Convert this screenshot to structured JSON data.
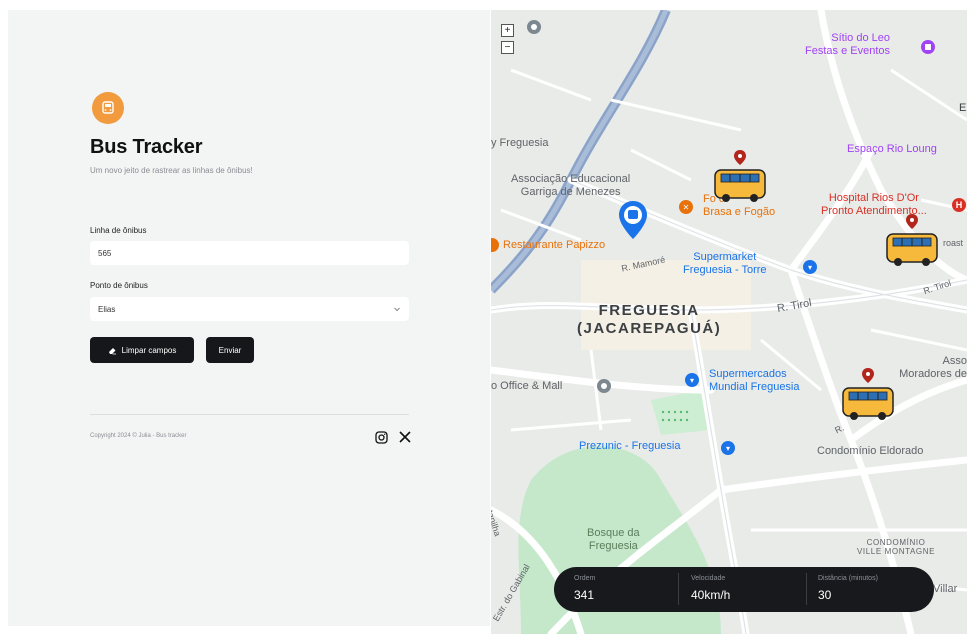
{
  "app": {
    "title": "Bus Tracker",
    "subtitle": "Um novo jeito de rastrear as linhas de ônibus!",
    "logo_icon": "bus-icon",
    "accent": "#f19a3e"
  },
  "form": {
    "line_label": "Linha de ônibus",
    "line_value": "565",
    "stop_label": "Ponto de ônibus",
    "stop_value": "Elias",
    "clear_button": "Limpar campos",
    "submit_button": "Enviar"
  },
  "footer": {
    "copyright": "Copyright 2024 © Julia - Bus tracker",
    "social": [
      "instagram-icon",
      "x-icon"
    ]
  },
  "map": {
    "zoom_in": "+",
    "zoom_out": "−",
    "district": [
      "FREGUESIA",
      "(JACAREPAGUÁ)"
    ],
    "places": {
      "sitio": [
        "Sítio do Leo",
        "Festas e Eventos"
      ],
      "freguesia_nw": "y Freguesia",
      "associacao": [
        "Associação Educacional",
        "Garriga de Menezes"
      ],
      "espaco": "Espaço Rio Loung",
      "hospital": [
        "Hospital Rios D'Or",
        "Pronto Atendimento..."
      ],
      "fogao": [
        "Fo        o",
        "Brasa e Fogão"
      ],
      "restaurante": "Restaurante Papizzo",
      "supermarket": [
        "Supermarket",
        "Freguesia - Torre"
      ],
      "office": "o Office & Mall",
      "supermercados": [
        "Supermercados",
        "Mundial Freguesia"
      ],
      "moradores": [
        "Asso",
        "Moradores de"
      ],
      "prezunic": "Prezunic - Freguesia",
      "condominio_eldorado": "Condomínio Eldorado",
      "bosque": [
        "Bosque da",
        "Freguesia"
      ],
      "ville": [
        "CONDOMÍNIO",
        "VILLE MONTAGNE"
      ],
      "villar": "Villar",
      "e_edge": "E"
    },
    "streets": {
      "mamore": "R. Mamoré",
      "tirol1": "R. Tirol",
      "tirol2": "R. Tirol",
      "quintanilha": "R. Quintanilha",
      "gabinal": "Estr. do Gabinal",
      "roast": "roast",
      "rua_r": "R."
    },
    "colors": {
      "park": "#c5e8cb",
      "road": "#ffffff",
      "highway": "#8ba3c9",
      "bus_yellow": "#f6b93b"
    }
  },
  "info_bar": {
    "order_label": "Ordem",
    "order_value": "341",
    "speed_label": "Velocidade",
    "speed_value": "40km/h",
    "distance_label": "Distância (minutos)",
    "distance_value": "30"
  }
}
